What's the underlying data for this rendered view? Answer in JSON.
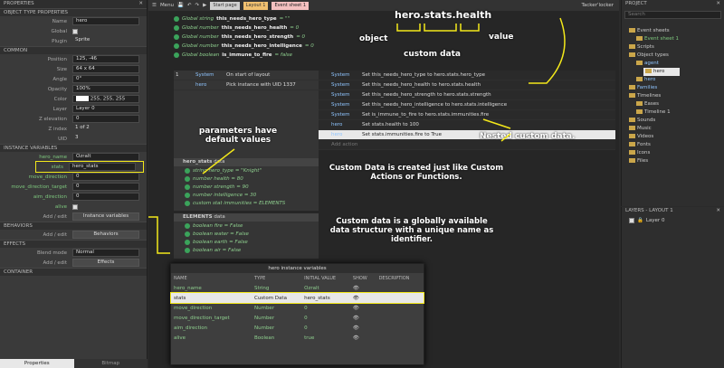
{
  "properties": {
    "title": "PROPERTIES",
    "object_type_header": "OBJECT TYPE PROPERTIES",
    "name_label": "Name",
    "name_value": "hero",
    "global_label": "Global",
    "plugin_label": "Plugin",
    "plugin_value": "Sprite",
    "common_header": "COMMON",
    "position_label": "Position",
    "position_value": "125, -46",
    "size_label": "Size",
    "size_value": "64 x 64",
    "angle_label": "Angle",
    "angle_value": "0°",
    "opacity_label": "Opacity",
    "opacity_value": "100%",
    "color_label": "Color",
    "color_value": "255, 255, 255",
    "layer_label": "Layer",
    "layer_value": "Layer 0",
    "zelev_label": "Z elevation",
    "zelev_value": "0",
    "zindex_label": "Z index",
    "zindex_value": "1 of 2",
    "uid_label": "UID",
    "uid_value": "3",
    "instvars_header": "INSTANCE VARIABLES",
    "hero_name_label": "hero_name",
    "hero_name_value": "Ozralt",
    "stats_label": "stats",
    "stats_value": "hero_stats",
    "move_direction_label": "move_direction",
    "move_direction_value": "0",
    "move_target_label": "move_direction_target",
    "move_target_value": "0",
    "aim_label": "aim_direction",
    "aim_value": "0",
    "alive_label": "alive",
    "addedit_label": "Add / edit",
    "instvars_button": "Instance variables",
    "behaviors_header": "BEHAVIORS",
    "behaviors_button": "Behaviors",
    "effects_header": "EFFECTS",
    "blend_label": "Blend mode",
    "blend_value": "Normal",
    "effects_button": "Effects",
    "container_header": "CONTAINER"
  },
  "bottom_tabs": [
    "Properties",
    "Bitmap"
  ],
  "toolbar": {
    "menu": "Menu",
    "tabs": [
      "Start page",
      "Layout 1",
      "Event sheet 1"
    ],
    "user": "Tacker'locker"
  },
  "globals": [
    {
      "kind": "Global string",
      "name": "this_needs_hero_type",
      "rest": "= \"\""
    },
    {
      "kind": "Global number",
      "name": "this_needs_hero_health",
      "rest": "= 0"
    },
    {
      "kind": "Global number",
      "name": "this_needs_hero_strength",
      "rest": "= 0"
    },
    {
      "kind": "Global number",
      "name": "this_needs_hero_intelligence",
      "rest": "= 0"
    },
    {
      "kind": "Global boolean",
      "name": "is_immune_to_fire",
      "rest": "= false"
    }
  ],
  "event": {
    "num": "1",
    "cond1_obj": "System",
    "cond1": "On start of layout",
    "cond2_obj": "hero",
    "cond2": "Pick instance with UID 1337"
  },
  "actions": [
    {
      "obj": "System",
      "text": "Set this_needs_hero_type to hero.stats.hero_type"
    },
    {
      "obj": "System",
      "text": "Set this_needs_hero_health to hero.stats.health"
    },
    {
      "obj": "System",
      "text": "Set this_needs_hero_strength to hero.stats.strength"
    },
    {
      "obj": "System",
      "text": "Set this_needs_hero_intelligence to hero.stats.intelligence"
    },
    {
      "obj": "System",
      "text": "Set is_immune_to_fire to hero.stats.immunities.fire"
    },
    {
      "obj": "hero",
      "text": "Set stats.health to 100"
    },
    {
      "obj": "hero",
      "text": "Set stats.immunities.fire to True"
    }
  ],
  "add_action": "Add action",
  "hero_stats": {
    "title": "hero_stats",
    "suffix": "data",
    "fields": [
      "string hero_type = \"Knight\"",
      "number health = 80",
      "number strength = 90",
      "number intelligence = 30",
      "custom stat immunities = ELEMENTS"
    ]
  },
  "elements": {
    "title": "ELEMENTS",
    "suffix": "data",
    "fields": [
      "boolean fire = False",
      "boolean water = False",
      "boolean earth = False",
      "boolean air = False"
    ]
  },
  "annotations": {
    "path": "hero.stats.health",
    "object": "object",
    "custom_data": "custom data",
    "value": "value",
    "params": "parameters have default values",
    "nested": "Nested custom data.",
    "like": "Custom Data is created just like Custom Actions or Functions.",
    "global": "Custom data is a globally available data structure with a unique name as identifier."
  },
  "project": {
    "title": "PROJECT",
    "search_placeholder": "Search",
    "items": [
      {
        "label": "Event sheets",
        "indent": 1
      },
      {
        "label": "Event sheet 1",
        "indent": 2,
        "green": true
      },
      {
        "label": "Scripts",
        "indent": 1
      },
      {
        "label": "Object types",
        "indent": 1
      },
      {
        "label": "agent",
        "indent": 2,
        "blue": true
      },
      {
        "label": "hero",
        "indent": 3,
        "sel": true
      },
      {
        "label": "hero",
        "indent": 2,
        "blue": true
      },
      {
        "label": "Families",
        "indent": 1,
        "blue": true
      },
      {
        "label": "Timelines",
        "indent": 1
      },
      {
        "label": "Eases",
        "indent": 2
      },
      {
        "label": "Timeline 1",
        "indent": 2
      },
      {
        "label": "Sounds",
        "indent": 1
      },
      {
        "label": "Music",
        "indent": 1
      },
      {
        "label": "Videos",
        "indent": 1
      },
      {
        "label": "Fonts",
        "indent": 1
      },
      {
        "label": "Icons",
        "indent": 1
      },
      {
        "label": "Files",
        "indent": 1
      }
    ]
  },
  "layers": {
    "title": "LAYERS - LAYOUT 1",
    "layer": "Layer 0"
  },
  "dialog": {
    "title": "hero instance variables",
    "cols": [
      "NAME",
      "TYPE",
      "INITIAL VALUE",
      "SHOW",
      "DESCRIPTION"
    ],
    "rows": [
      [
        "hero_name",
        "String",
        "Ozralt"
      ],
      [
        "stats",
        "Custom Data",
        "hero_stats"
      ],
      [
        "move_direction",
        "Number",
        "0"
      ],
      [
        "move_direction_target",
        "Number",
        "0"
      ],
      [
        "aim_direction",
        "Number",
        "0"
      ],
      [
        "alive",
        "Boolean",
        "true"
      ]
    ]
  },
  "colors": {
    "accent": "#f3e81a",
    "green": "#3ba35b"
  }
}
